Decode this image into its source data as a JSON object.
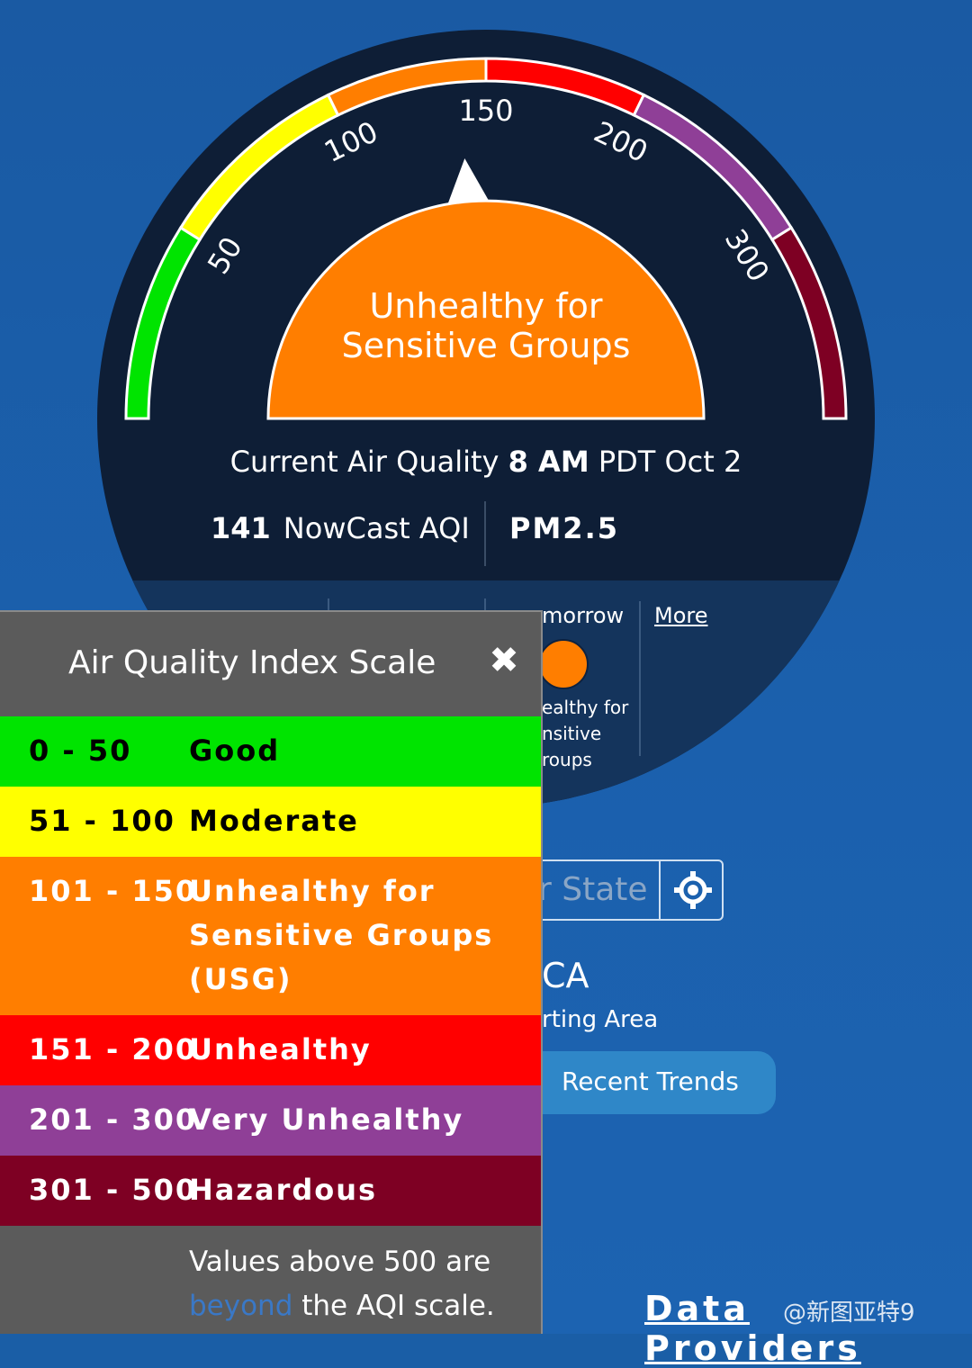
{
  "gauge": {
    "ticks": [
      "50",
      "100",
      "150",
      "200",
      "300"
    ],
    "category_line1": "Unhealthy for",
    "category_line2": "Sensitive Groups",
    "current_prefix": "Current Air Quality",
    "current_time": "8  AM",
    "current_suffix": "PDT Oct 2",
    "aqi_value": "141",
    "aqi_label": "NowCast AQI",
    "pollutant": "PM2.5",
    "aqi_needle": 141,
    "colors": {
      "good": "#00e400",
      "moderate": "#ffff00",
      "usg": "#ff7e00",
      "unhealthy": "#ff0000",
      "very_unhealthy": "#8f3f97",
      "hazardous": "#7e0023"
    }
  },
  "forecast": {
    "tomorrow_label": "morrow",
    "more_link": "More",
    "tomorrow_category": [
      "ealthy for",
      "nsitive",
      "roups"
    ]
  },
  "search": {
    "placeholder": "r State",
    "locate_icon": "crosshair-icon"
  },
  "location": {
    "city": "CA",
    "area": "rting Area"
  },
  "buttons": {
    "recent_trends": "Recent Trends"
  },
  "footer": {
    "data_providers": "Data Providers",
    "watermark": "@新图亚特9"
  },
  "modal": {
    "title": "Air Quality Index Scale",
    "close_icon": "close-icon",
    "rows": [
      {
        "range": "0 - 50",
        "label": [
          "Good"
        ],
        "color": "#00e400",
        "text_color": "#000000"
      },
      {
        "range": "51 - 100",
        "label": [
          "Moderate"
        ],
        "color": "#ffff00",
        "text_color": "#000000"
      },
      {
        "range": "101 - 150",
        "label": [
          "Unhealthy for",
          "Sensitive Groups",
          "(USG)"
        ],
        "color": "#ff7e00",
        "text_color": "#ffffff"
      },
      {
        "range": "151 - 200",
        "label": [
          "Unhealthy"
        ],
        "color": "#ff0000",
        "text_color": "#ffffff"
      },
      {
        "range": "201 - 300",
        "label": [
          "Very Unhealthy"
        ],
        "color": "#8f3f97",
        "text_color": "#ffffff"
      },
      {
        "range": "301 - 500",
        "label": [
          "Hazardous"
        ],
        "color": "#7e0023",
        "text_color": "#ffffff"
      }
    ],
    "note_line1": "Values above 500 are",
    "note_link": "beyond",
    "note_line2_rest": " the AQI scale."
  }
}
